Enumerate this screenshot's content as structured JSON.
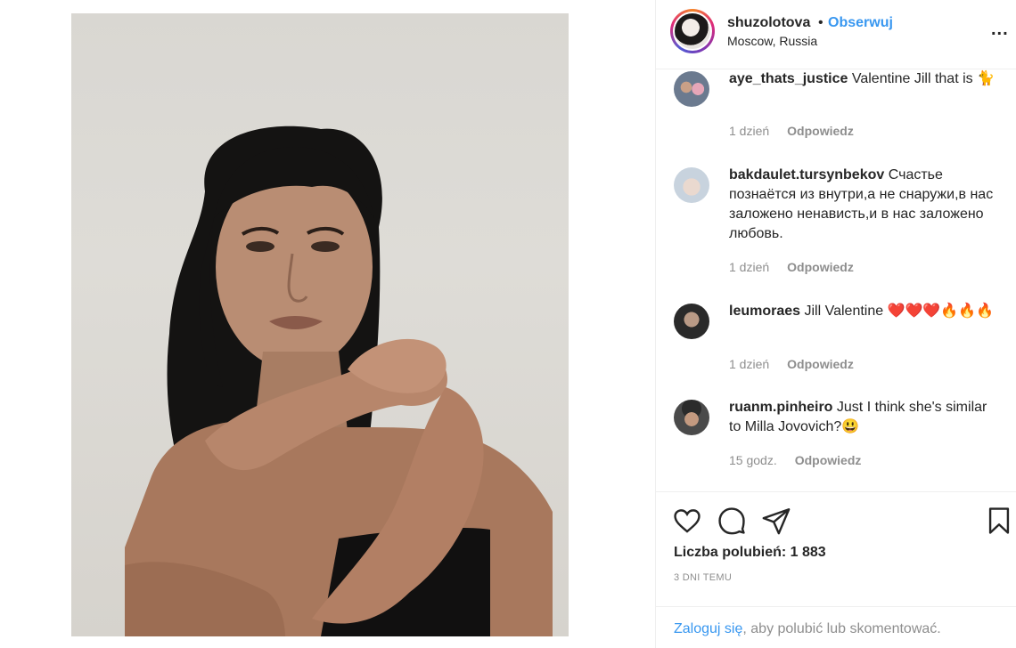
{
  "post": {
    "photo_icon": "portrait-photo"
  },
  "header": {
    "username": "shuzolotova",
    "separator": "•",
    "follow_label": "Obserwuj",
    "location": "Moscow, Russia",
    "more_label": "..."
  },
  "comments": [
    {
      "username": "aye_thats_justice",
      "text": "Valentine Jill that is 🐈",
      "age": "1 dzień",
      "reply_label": "Odpowiedz"
    },
    {
      "username": "bakdaulet.tursynbekov",
      "text": "Счастье познаётся из внутри,а не снаружи,в нас заложено ненависть,и в нас заложено любовь.",
      "age": "1 dzień",
      "reply_label": "Odpowiedz"
    },
    {
      "username": "leumoraes",
      "text": "Jill Valentine ❤️❤️❤️🔥🔥🔥",
      "age": "1 dzień",
      "reply_label": "Odpowiedz"
    },
    {
      "username": "ruanm.pinheiro",
      "text": "Just I think she's similar to Milla Jovovich?😃",
      "age": "15 godz.",
      "reply_label": "Odpowiedz"
    }
  ],
  "actions": {
    "icons": [
      "heart-icon",
      "comment-icon",
      "share-icon",
      "bookmark-icon"
    ],
    "likes": "Liczba polubień: 1 883",
    "time": "3 DNI TEMU"
  },
  "login": {
    "link_label": "Zaloguj się",
    "rest": ", aby polubić lub skomentować."
  },
  "colors": {
    "accent": "#3897f0",
    "text": "#262626",
    "muted": "#8e8e8e"
  }
}
